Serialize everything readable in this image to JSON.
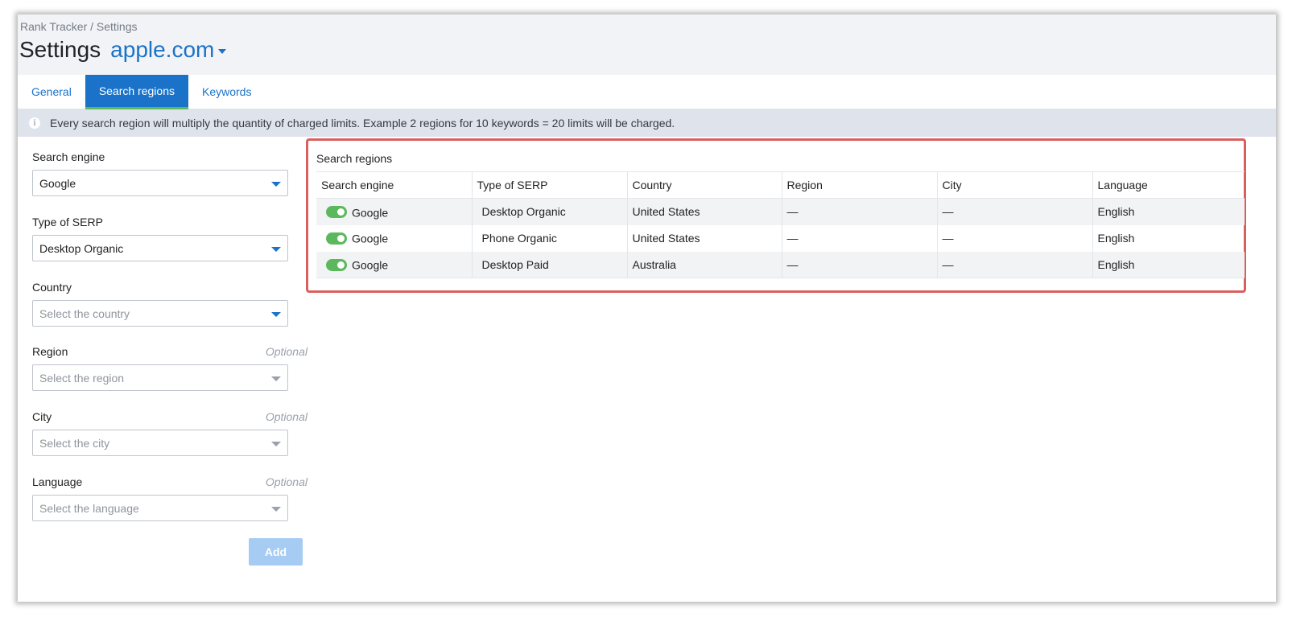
{
  "breadcrumb": "Rank Tracker / Settings",
  "page_title": "Settings",
  "project": {
    "name": "apple.com",
    "icon": "caret-down-icon"
  },
  "tabs": [
    {
      "label": "General",
      "active": false
    },
    {
      "label": "Search regions",
      "active": true
    },
    {
      "label": "Keywords",
      "active": false
    }
  ],
  "info": {
    "icon": "info-icon",
    "text": "Every search region will multiply the quantity of charged limits. Example 2 regions for 10 keywords = 20 limits will be charged."
  },
  "form": {
    "search_engine": {
      "label": "Search engine",
      "value": "Google"
    },
    "serp_type": {
      "label": "Type of SERP",
      "value": "Desktop Organic"
    },
    "country": {
      "label": "Country",
      "placeholder": "Select the country"
    },
    "region": {
      "label": "Region",
      "optional": "Optional",
      "placeholder": "Select the region"
    },
    "city": {
      "label": "City",
      "optional": "Optional",
      "placeholder": "Select the city"
    },
    "language": {
      "label": "Language",
      "optional": "Optional",
      "placeholder": "Select the language"
    },
    "add_label": "Add"
  },
  "regions": {
    "title": "Search regions",
    "columns": [
      "Search engine",
      "Type of SERP",
      "Country",
      "Region",
      "City",
      "Language"
    ],
    "rows": [
      {
        "enabled": true,
        "engine": "Google",
        "serp": "Desktop Organic",
        "country": "United States",
        "region": "—",
        "city": "—",
        "language": "English"
      },
      {
        "enabled": true,
        "engine": "Google",
        "serp": "Phone Organic",
        "country": "United States",
        "region": "—",
        "city": "—",
        "language": "English"
      },
      {
        "enabled": true,
        "engine": "Google",
        "serp": "Desktop Paid",
        "country": "Australia",
        "region": "—",
        "city": "—",
        "language": "English"
      }
    ]
  },
  "colors": {
    "accent": "#1a73c9",
    "toggle_on": "#5cb85c",
    "highlight_border": "#d9605f",
    "info_bar": "#dfe3ec",
    "button_disabled": "#a6ccf3"
  }
}
